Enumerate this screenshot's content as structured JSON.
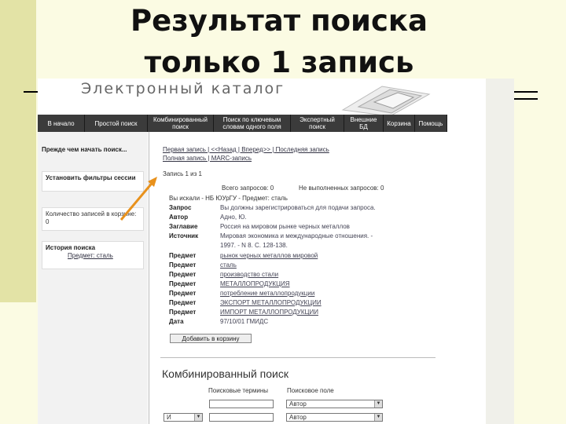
{
  "slide": {
    "title_line1": "Результат поиска",
    "title_line2": "только 1 запись"
  },
  "catalog": {
    "title": "Электронный каталог"
  },
  "nav": {
    "items": [
      "В начало",
      "Простой поиск",
      "Комбинированный поиск",
      "Поиск по ключевым словам одного поля",
      "Экспертный поиск",
      "Внешние БД",
      "Корзина",
      "Помощь"
    ]
  },
  "sidebar": {
    "header": "Прежде чем начать поиск...",
    "filters": "Установить фильтры сессии",
    "cart": "Количество записей в корзине: 0",
    "history_title": "История поиска",
    "history_item": "Предмет: сталь"
  },
  "content": {
    "nav_links": "Первая запись | <<Назад | Вперед>> | Последняя запись",
    "format_link": "Полная запись | MARC-запись",
    "record_num": "Запись 1 из 1",
    "total_requests": "Всего запросов: 0",
    "unfulfilled": "Не выполненных запросов: 0",
    "search_info": "Вы искали - НБ ЮУрГУ - Предмет: сталь",
    "add_button": "Добавить в корзину"
  },
  "record": [
    {
      "label": "Запрос",
      "value": "Вы должны зарегистрироваться для подачи запроса."
    },
    {
      "label": "Автор",
      "value": "Адно, Ю."
    },
    {
      "label": "Заглавие",
      "value": "Россия на мировом рынке черных металлов"
    },
    {
      "label": "Источник",
      "value": "Мировая экономика и международные отношения. -"
    },
    {
      "label": "",
      "value": "1997. - N 8. C. 128-138."
    },
    {
      "label": "Предмет",
      "value": "рынок черных металлов мировой"
    },
    {
      "label": "Предмет",
      "value": "сталь"
    },
    {
      "label": "Предмет",
      "value": "производство стали"
    },
    {
      "label": "Предмет",
      "value": "МЕТАЛЛОПРОДУКЦИЯ"
    },
    {
      "label": "Предмет",
      "value": "потребление металлопродукции"
    },
    {
      "label": "Предмет",
      "value": "ЭКСПОРТ МЕТАЛЛОПРОДУКЦИИ"
    },
    {
      "label": "Предмет",
      "value": "ИМПОРТ МЕТАЛЛОПРОДУКЦИИ"
    },
    {
      "label": "Дата",
      "value": "97/10/01 ГМИДС"
    }
  ],
  "combined": {
    "title": "Комбинированный поиск",
    "col_terms": "Поисковые термины",
    "col_field": "Поисковое поле",
    "field_select_1": "Автор",
    "field_select_2": "Автор",
    "operator": "И"
  }
}
